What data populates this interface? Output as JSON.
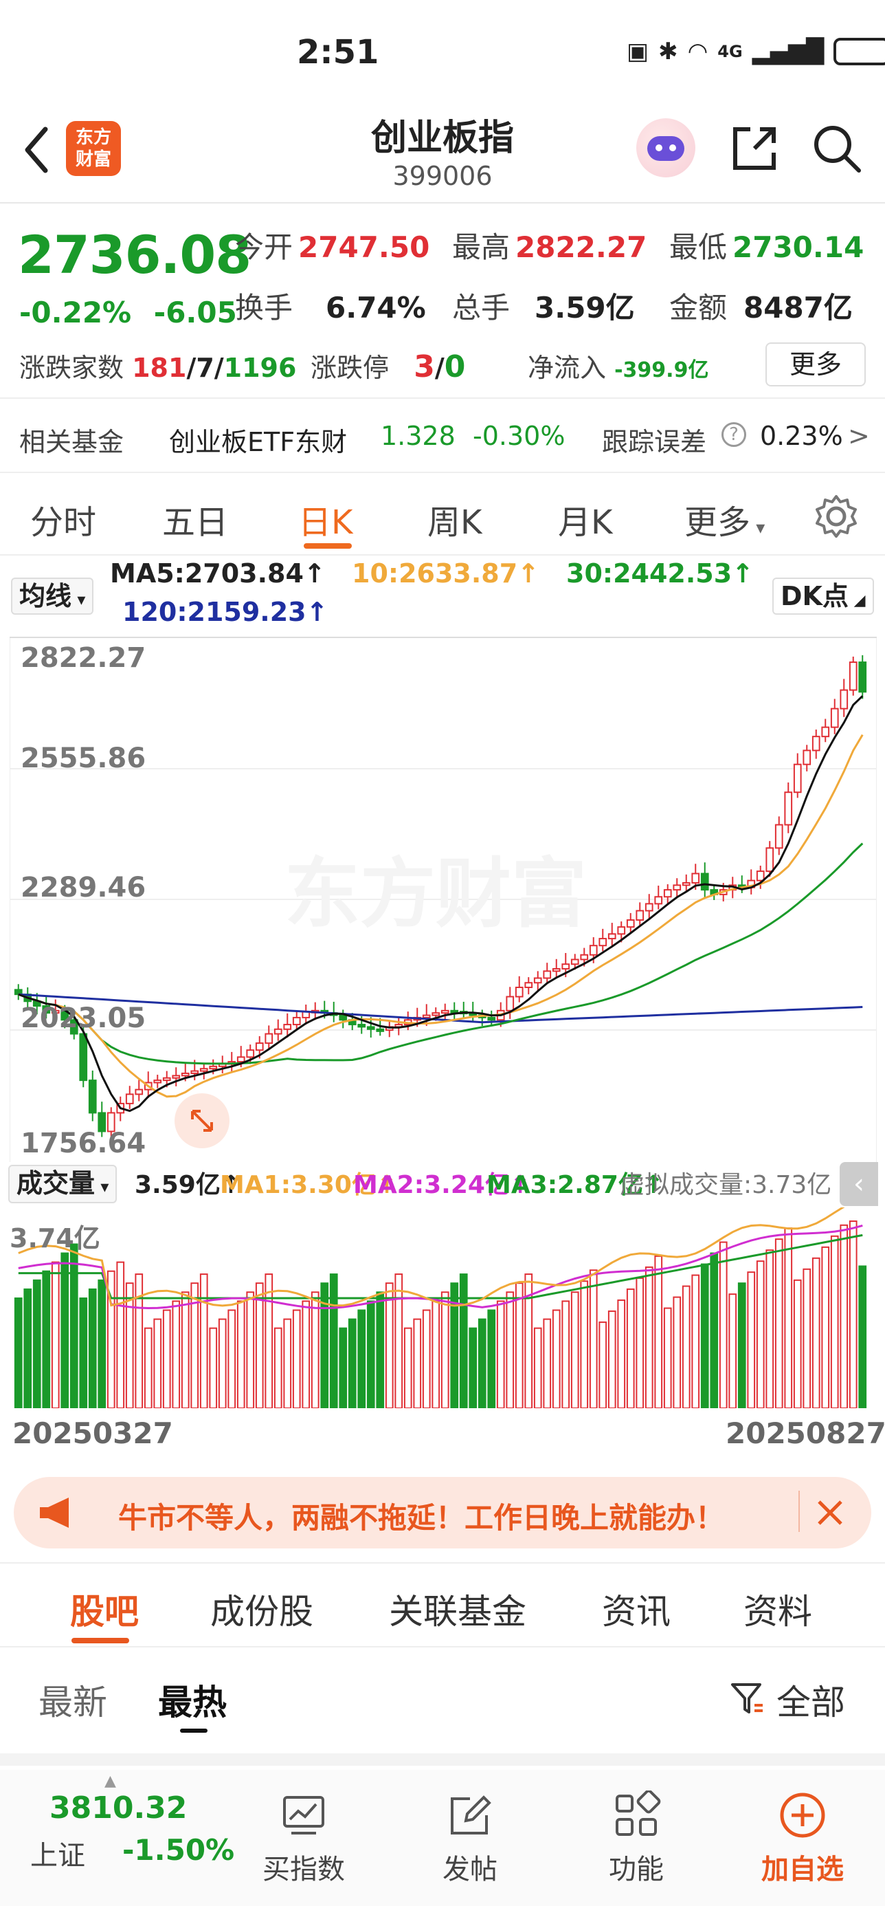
{
  "status": {
    "time": "2:51",
    "network": "4G",
    "signal_icons": [
      "nfc-icon",
      "bluetooth-icon",
      "wifi-icon",
      "signal-icon",
      "battery-icon"
    ]
  },
  "header": {
    "title": "创业板指",
    "code": "399006",
    "logo_text": "东方\n财富"
  },
  "quote": {
    "price": "2736.08",
    "change_pct": "-0.22%",
    "change": "-6.05",
    "open_label": "今开",
    "open": "2747.50",
    "high_label": "最高",
    "high": "2822.27",
    "low_label": "最低",
    "low": "2730.14",
    "turnover_label": "换手",
    "turnover": "6.74%",
    "volume_label": "总手",
    "volume": "3.59亿",
    "amount_label": "金额",
    "amount": "8487亿",
    "breadth_label": "涨跌家数",
    "up": "181",
    "flat": "7",
    "down": "1196",
    "limit_label": "涨跌停",
    "limit_up": "3",
    "limit_down": "0",
    "flow_label": "净流入",
    "flow": "-399.9亿",
    "more": "更多"
  },
  "fund": {
    "label": "相关基金",
    "name": "创业板ETF东财",
    "price": "1.328",
    "pct": "-0.30%",
    "track_label": "跟踪误差",
    "track": "0.23%",
    "arrow": ">"
  },
  "tabs": [
    "分时",
    "五日",
    "日K",
    "周K",
    "月K",
    "更多"
  ],
  "ma": {
    "selector": "均线",
    "ma5": "MA5:2703.84↑",
    "ma10": "10:2633.87↑",
    "ma30": "30:2442.53↑",
    "ma120": "120:2159.23↑",
    "dk": "DK点"
  },
  "price_axis": [
    "2822.27",
    "2555.86",
    "2289.46",
    "2023.05",
    "1756.64"
  ],
  "volume_head": {
    "selector": "成交量",
    "vol": "3.59亿↑",
    "ma1": "MA1:3.30亿↑",
    "ma2": "MA2:3.24亿↑",
    "ma3": "MA3:2.87亿↑",
    "virtual": "虚拟成交量:3.73亿"
  },
  "volume_axis": "3.74亿",
  "dates": {
    "start": "20250327",
    "end": "20250827"
  },
  "watermark": "东方财富",
  "promo": {
    "text": "牛市不等人，两融不拖延！工作日晚上就能办！"
  },
  "bottom_tabs": [
    "股吧",
    "成份股",
    "关联基金",
    "资讯",
    "资料"
  ],
  "sub_tabs": {
    "latest": "最新",
    "hot": "最热",
    "filter": "全部"
  },
  "nav": {
    "index_price": "3810.32",
    "index_name": "上证",
    "index_pct": "-1.50%",
    "buy": "买指数",
    "post": "发帖",
    "func": "功能",
    "add": "加自选"
  },
  "colors": {
    "up": "#e02f35",
    "down": "#1a9a2a",
    "accent": "#ef6a1f",
    "ma5": "#111111",
    "ma10": "#f0a93a",
    "ma30": "#1a9a2a",
    "ma120": "#1f2fa0"
  },
  "chart_data": {
    "type": "candlestick",
    "x_range": [
      "20250327",
      "20250827"
    ],
    "ylim": [
      1756.64,
      2822.27
    ],
    "closes": [
      2085,
      2070,
      2060,
      2045,
      2050,
      2030,
      2000,
      1900,
      1830,
      1790,
      1830,
      1850,
      1870,
      1880,
      1895,
      1900,
      1905,
      1910,
      1915,
      1920,
      1925,
      1930,
      1935,
      1940,
      1950,
      1965,
      1980,
      2000,
      2010,
      2020,
      2035,
      2048,
      2050,
      2045,
      2040,
      2030,
      2020,
      2015,
      2010,
      2008,
      2015,
      2020,
      2030,
      2035,
      2040,
      2045,
      2050,
      2048,
      2045,
      2040,
      2035,
      2030,
      2050,
      2080,
      2100,
      2110,
      2120,
      2135,
      2140,
      2150,
      2160,
      2170,
      2190,
      2205,
      2215,
      2230,
      2245,
      2265,
      2280,
      2295,
      2310,
      2320,
      2325,
      2345,
      2310,
      2300,
      2310,
      2320,
      2315,
      2330,
      2350,
      2400,
      2450,
      2520,
      2580,
      2610,
      2640,
      2660,
      2700,
      2740,
      2800,
      2736
    ],
    "volume_ylim": [
      0,
      3.74
    ]
  }
}
